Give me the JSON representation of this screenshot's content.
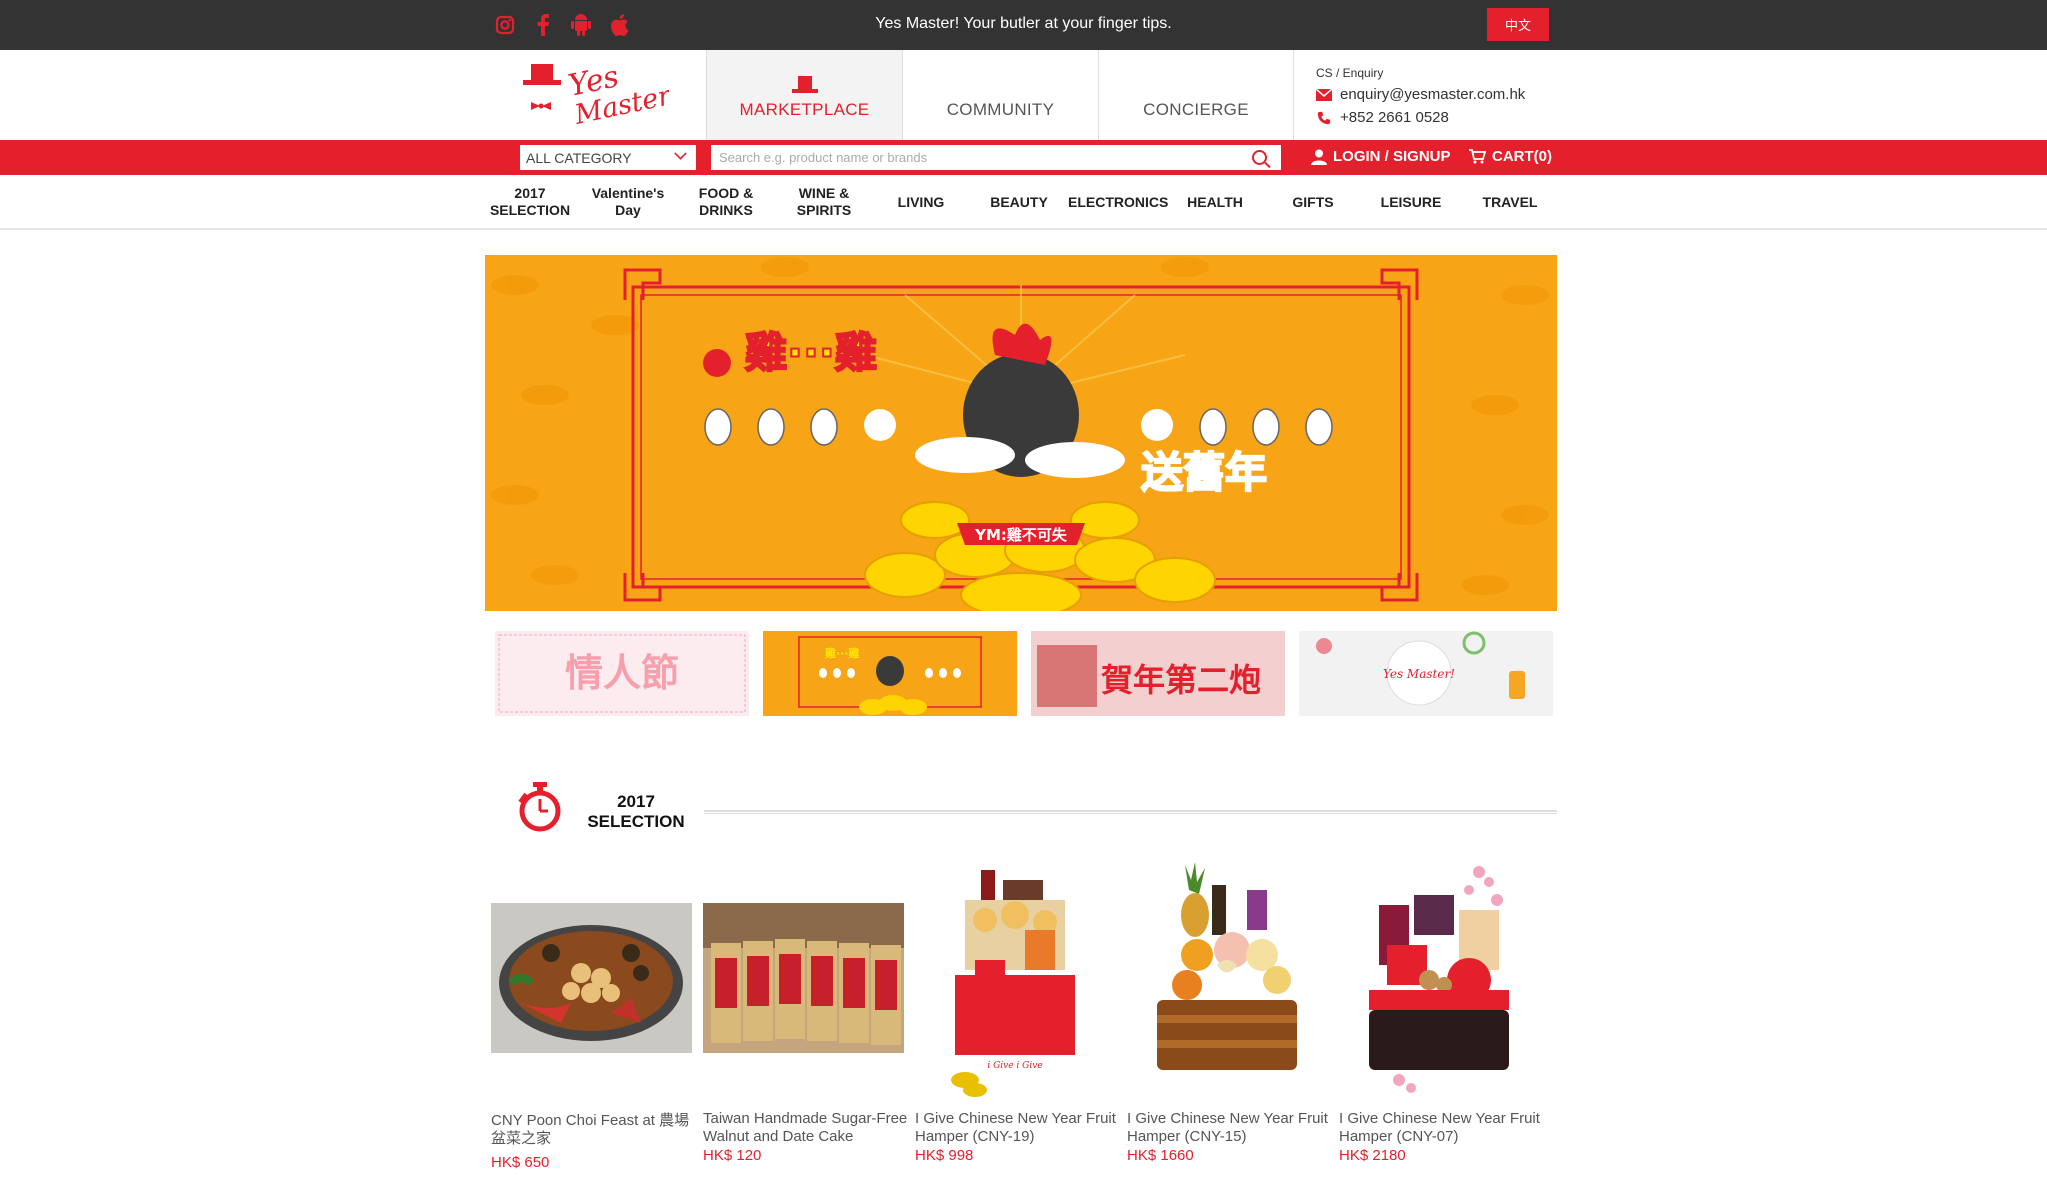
{
  "topbar": {
    "social_icons": [
      "instagram-icon",
      "facebook-icon",
      "android-icon",
      "apple-icon"
    ],
    "tagline": "Yes Master! Your butler at your finger tips.",
    "lang_button": "中文"
  },
  "header": {
    "logo_text": "Yes Master!",
    "tabs": [
      {
        "label": "MARKETPLACE",
        "active": true
      },
      {
        "label": "COMMUNITY",
        "active": false
      },
      {
        "label": "CONCIERGE",
        "active": false
      }
    ],
    "contact": {
      "label": "CS / Enquiry",
      "email": "enquiry@yesmaster.com.hk",
      "phone": "+852 2661 0528"
    }
  },
  "searchbar": {
    "category": "ALL CATEGORY",
    "placeholder": "Search e.g. product name or brands",
    "login": "LOGIN / SIGNUP",
    "cart": "CART(0)"
  },
  "categories": [
    [
      "2017",
      "SELECTION"
    ],
    [
      "Valentine's",
      "Day"
    ],
    [
      "FOOD &",
      "DRINKS"
    ],
    [
      "WINE &",
      "SPIRITS"
    ],
    [
      "LIVING"
    ],
    [
      "BEAUTY"
    ],
    [
      "ELECTRONICS"
    ],
    [
      "HEALTH"
    ],
    [
      "GIFTS"
    ],
    [
      "LEISURE"
    ],
    [
      "TRAVEL"
    ]
  ],
  "banner": {
    "headline_left": "雞···雞",
    "headline_right": "送舊年",
    "badge": "YM:雞不可失"
  },
  "thumbnails": [
    {
      "text": "情人節"
    },
    {
      "text": "雞···雞"
    },
    {
      "text": "賀年第二炮"
    },
    {
      "text": "Yes Master!"
    }
  ],
  "section": {
    "title_line1": "2017",
    "title_line2": "SELECTION"
  },
  "products": [
    {
      "name": "CNY Poon Choi Feast at 農場盆菜之家",
      "price": "HK$ 650"
    },
    {
      "name": "Taiwan Handmade Sugar-Free Walnut and Date Cake",
      "price": "HK$ 120"
    },
    {
      "name": "I Give Chinese New Year Fruit Hamper (CNY-19)",
      "price": "HK$ 998"
    },
    {
      "name": "I Give Chinese New Year Fruit Hamper (CNY-15)",
      "price": "HK$ 1660"
    },
    {
      "name": "I Give Chinese New Year Fruit Hamper (CNY-07)",
      "price": "HK$ 2180"
    }
  ],
  "colors": {
    "brand_red": "#e5202d",
    "topbar": "#333333",
    "banner_orange": "#f7a416"
  }
}
